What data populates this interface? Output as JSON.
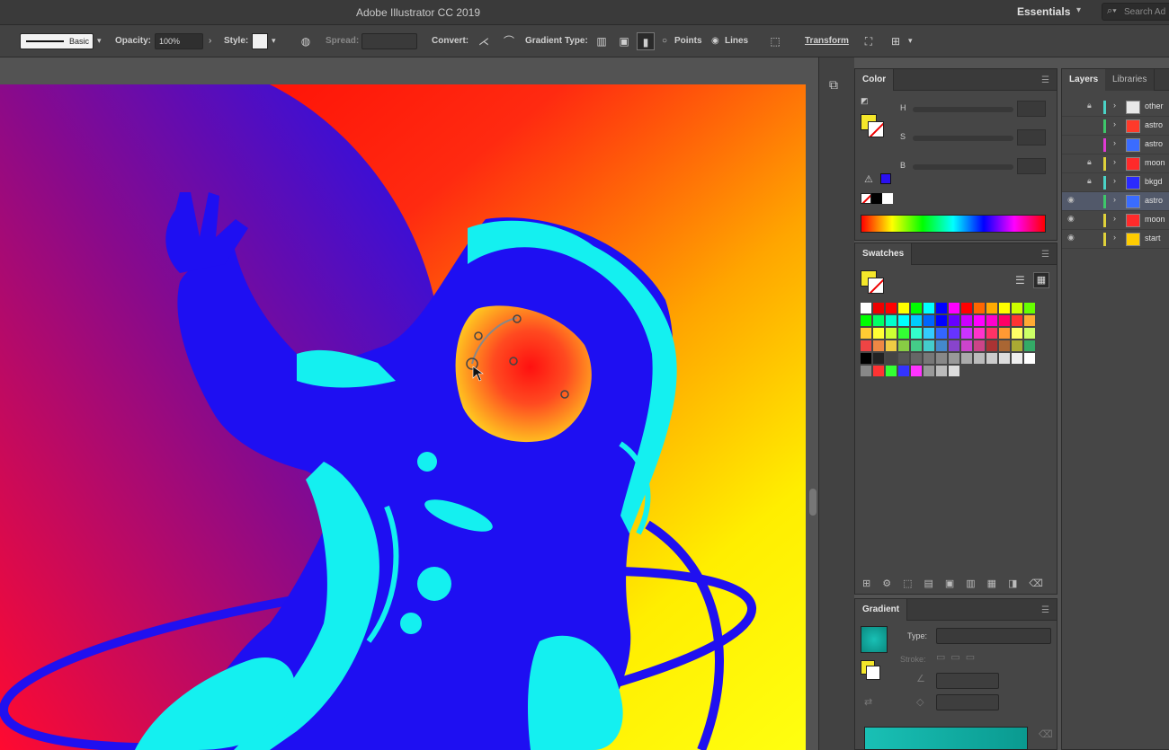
{
  "window": {
    "title": "Adobe Illustrator CC 2019"
  },
  "workspace": {
    "label": "Essentials",
    "search_placeholder": "Search Ad"
  },
  "controlbar": {
    "stroke_profile": "Basic",
    "opacity_label": "Opacity:",
    "opacity_value": "100%",
    "style_label": "Style:",
    "spread_label": "Spread:",
    "convert_label": "Convert:",
    "gradient_type_label": "Gradient Type:",
    "points_label": "Points",
    "lines_label": "Lines",
    "transform_label": "Transform"
  },
  "color_panel": {
    "tab": "Color",
    "h_label": "H",
    "s_label": "S",
    "b_label": "B"
  },
  "swatches_panel": {
    "tab": "Swatches"
  },
  "gradient_panel": {
    "tab": "Gradient",
    "type_label": "Type:",
    "stroke_label": "Stroke:"
  },
  "layers_panel": {
    "tabs": [
      "Layers",
      "Libraries"
    ],
    "layers": [
      {
        "name": "other",
        "color": "#4ad3c7",
        "thumb": "#e8e8e8",
        "locked": true,
        "visible": false,
        "selected": false
      },
      {
        "name": "astro",
        "color": "#3ec86a",
        "thumb": "#ff3a2a",
        "locked": false,
        "visible": false,
        "selected": false
      },
      {
        "name": "astro",
        "color": "#e23ad4",
        "thumb": "#3a6cff",
        "locked": false,
        "visible": false,
        "selected": false
      },
      {
        "name": "moon",
        "color": "#e0d23a",
        "thumb": "#ff2a2a",
        "locked": true,
        "visible": false,
        "selected": false
      },
      {
        "name": "bkgd",
        "color": "#4ad3c7",
        "thumb": "#2a2aff",
        "locked": true,
        "visible": false,
        "selected": false
      },
      {
        "name": "astro",
        "color": "#3ec86a",
        "thumb": "#3a6cff",
        "locked": false,
        "visible": true,
        "selected": true
      },
      {
        "name": "moon",
        "color": "#e0d23a",
        "thumb": "#ff2a2a",
        "locked": false,
        "visible": true,
        "selected": false
      },
      {
        "name": "start",
        "color": "#e0d23a",
        "thumb": "#ffcc00",
        "locked": false,
        "visible": true,
        "selected": false
      }
    ]
  },
  "colors": {
    "fill": "#f5e72a",
    "accent_blue": "#1d0ff0",
    "cyan": "#16f0f0"
  }
}
